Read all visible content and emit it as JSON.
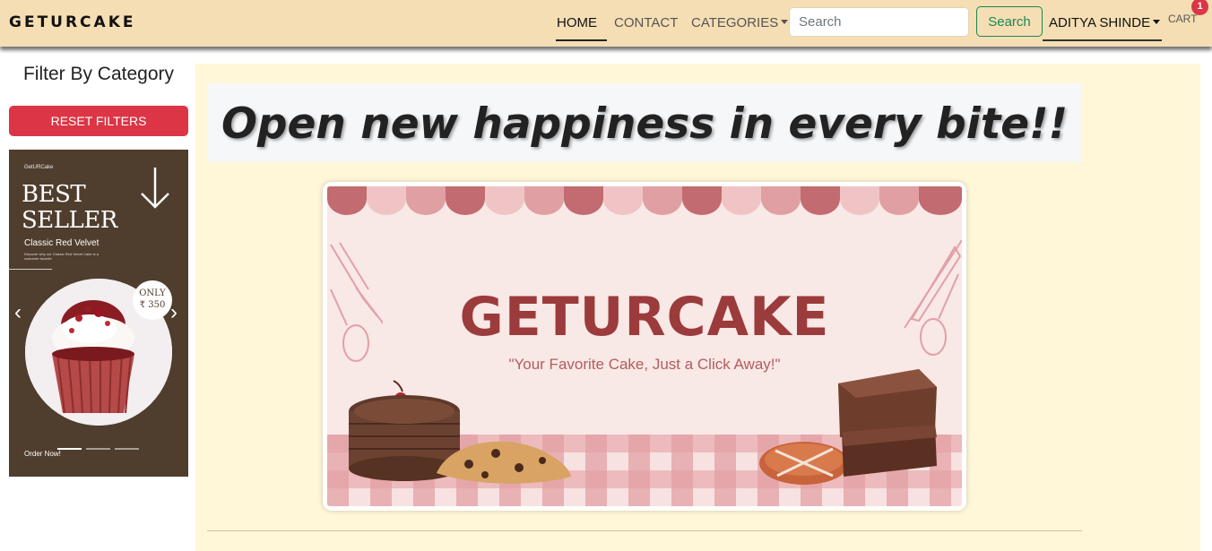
{
  "navbar": {
    "brand": "GETURCAKE",
    "links": [
      {
        "label": "HOME",
        "active": true
      },
      {
        "label": "CONTACT"
      },
      {
        "label": "CATEGORIES"
      }
    ],
    "search": {
      "placeholder": "Search",
      "value": ""
    },
    "search_button": "Search",
    "user": "ADITYA SHINDE",
    "cart_label": "CART",
    "cart_count": "1"
  },
  "sidebar": {
    "title": "Filter By Category",
    "reset_button": "RESET FILTERS"
  },
  "carousel": {
    "brand": "GetURCake",
    "heading": [
      "BEST",
      "SELLER"
    ],
    "product": "Classic Red Velvet",
    "description": "Discover why our Classic Red Velvet Cake is a customer favorite",
    "price_line1": "ONLY",
    "price_line2": "₹ 350",
    "cta": "Order Now!",
    "active_index": 0,
    "slides": 3
  },
  "main": {
    "hero_text": "Open new happiness in every bite!!",
    "banner": {
      "title": "GETURCAKE",
      "tagline": "\"Your Favorite Cake, Just a Click Away!\""
    }
  },
  "colors": {
    "navbar_bg": "#f5deb3",
    "main_bg": "#fff7d8",
    "danger": "#dc3545",
    "success": "#198754",
    "carousel_bg": "#4f3d2d",
    "banner_title": "#9b3b3b"
  }
}
